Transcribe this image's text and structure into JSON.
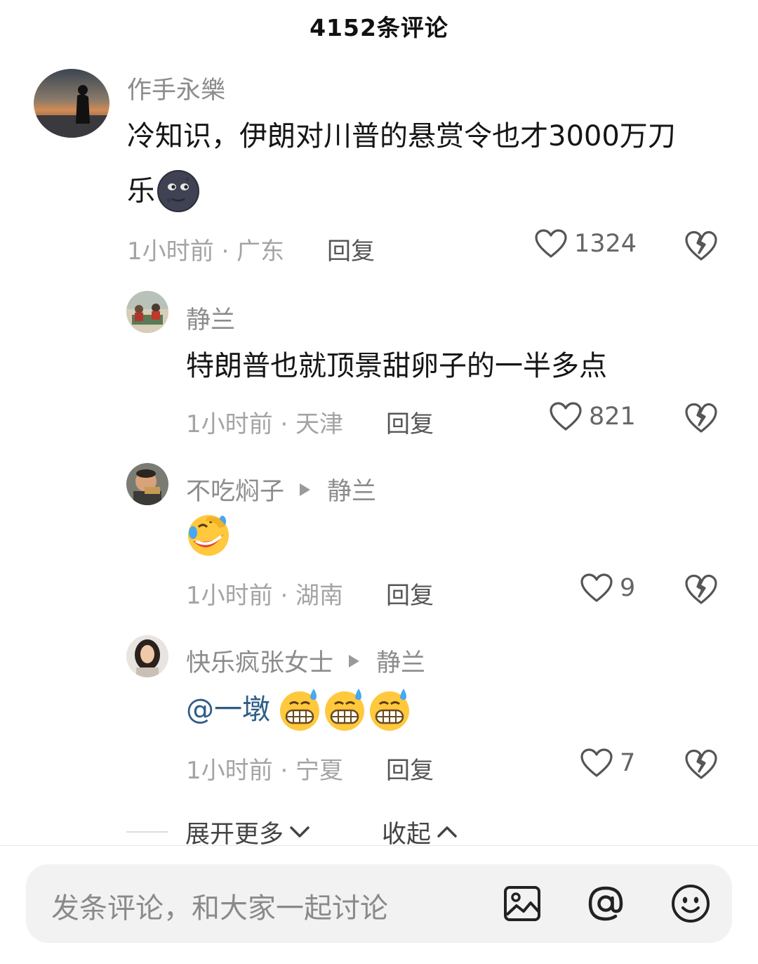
{
  "header": {
    "title": "4152条评论"
  },
  "comments": [
    {
      "user": "作手永樂",
      "text_line1": "冷知识，伊朗对川普的悬赏令也才3000万刀",
      "text_line2": "乐",
      "emoji": "new-moon-face",
      "time_location": "1小时前 · 广东",
      "reply_label": "回复",
      "likes": "1324"
    },
    {
      "user": "静兰",
      "text": "特朗普也就顶景甜卵子的一半多点",
      "time_location": "1小时前 · 天津",
      "reply_label": "回复",
      "likes": "821"
    },
    {
      "user": "不吃焖子",
      "reply_to": "静兰",
      "emoji": "rolling-laughing-face",
      "time_location": "1小时前 · 湖南",
      "reply_label": "回复",
      "likes": "9"
    },
    {
      "user": "快乐疯张女士",
      "reply_to": "静兰",
      "mention": "@一墩",
      "emoji": "grinning-sweat-face",
      "time_location": "1小时前 · 宁夏",
      "reply_label": "回复",
      "likes": "7"
    }
  ],
  "thread_controls": {
    "expand_label": "展开更多",
    "collapse_label": "收起"
  },
  "input": {
    "placeholder": "发条评论，和大家一起讨论"
  },
  "tools": [
    "image-icon",
    "at-icon",
    "emoji-face-icon"
  ],
  "colors": {
    "mention": "#2d5d87",
    "meta": "#a4a4a4",
    "username": "#8c8c8c"
  }
}
